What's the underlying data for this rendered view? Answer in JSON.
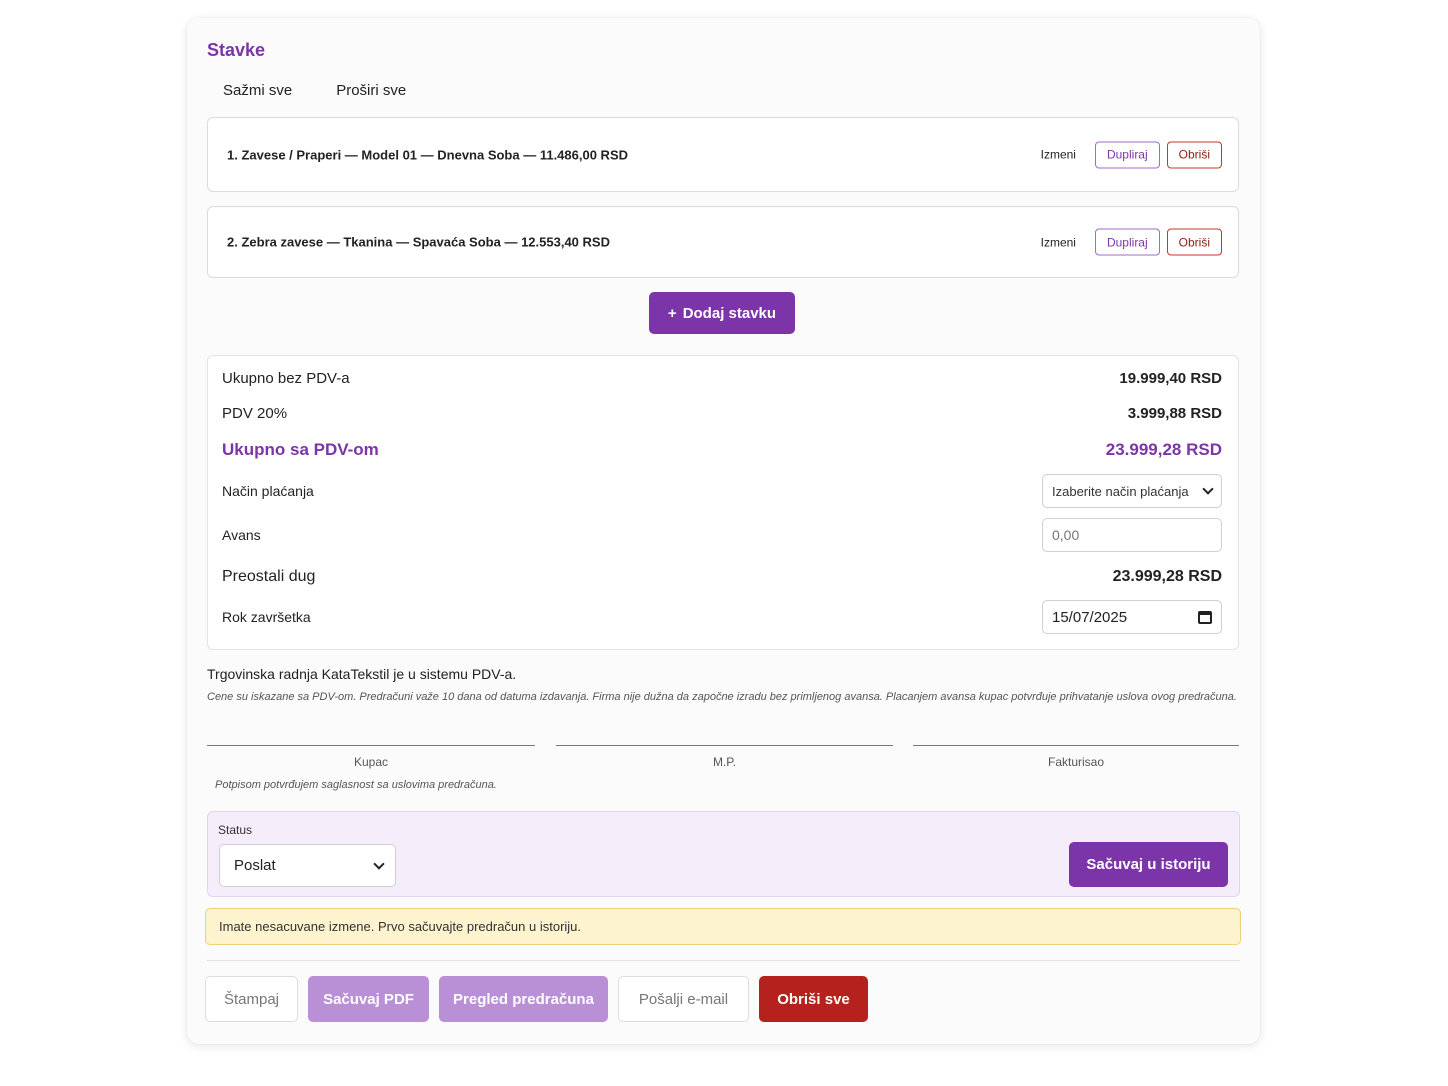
{
  "section": {
    "title": "Stavke",
    "collapse_all": "Sažmi sve",
    "expand_all": "Proširi sve"
  },
  "items": [
    {
      "title": "1. Zavese / Praperi — Model 01 — Dnevna Soba — 11.486,00 RSD",
      "edit": "Izmeni",
      "duplicate": "Dupliraj",
      "delete": "Obriši"
    },
    {
      "title": "2. Zebra zavese — Tkanina — Spavaća Soba — 12.553,40 RSD",
      "edit": "Izmeni",
      "duplicate": "Dupliraj",
      "delete": "Obriši"
    }
  ],
  "add_item": {
    "icon": "+",
    "label": "Dodaj stavku"
  },
  "totals": {
    "subtotal_label": "Ukupno bez PDV-a",
    "subtotal_value": "19.999,40 RSD",
    "vat_label": "PDV 20%",
    "vat_value": "3.999,88 RSD",
    "total_label": "Ukupno sa PDV-om",
    "total_value": "23.999,28 RSD",
    "payment_label": "Način plaćanja",
    "payment_placeholder": "Izaberite način plaćanja",
    "advance_label": "Avans",
    "advance_placeholder": "0,00",
    "remaining_label": "Preostali dug",
    "remaining_value": "23.999,28 RSD",
    "deadline_label": "Rok završetka",
    "deadline_value": "15/07/2025"
  },
  "notes": {
    "main": "Trgovinska radnja KataTekstil je u sistemu PDV-a.",
    "small": "Cene su iskazane sa PDV-om. Predračuni važe 10 dana od datuma izdavanja. Firma nije dužna da započne izradu bez primljenog avansa. Placanjem avansa kupac potvrđuje prihvatanje uslova ovog predračuna."
  },
  "signatures": {
    "buyer": "Kupac",
    "stamp": "M.P.",
    "invoiced_by": "Fakturisao",
    "note": "Potpisom potvrđujem saglasnost sa uslovima predračuna."
  },
  "status": {
    "label": "Status",
    "selected": "Poslat",
    "save_history": "Sačuvaj u istoriju"
  },
  "warning": "Imate nesacuvane izmene. Prvo sačuvajte predračun u istoriju.",
  "actions": {
    "print": "Štampaj",
    "save_pdf": "Sačuvaj PDF",
    "preview": "Pregled predračuna",
    "send_email": "Pošalji e-mail",
    "delete_all": "Obriši sve"
  },
  "colors": {
    "accent": "#7b35a8",
    "accent_light": "#b98fd6",
    "danger": "#b5211c",
    "warning_bg": "#fdf3cf"
  }
}
